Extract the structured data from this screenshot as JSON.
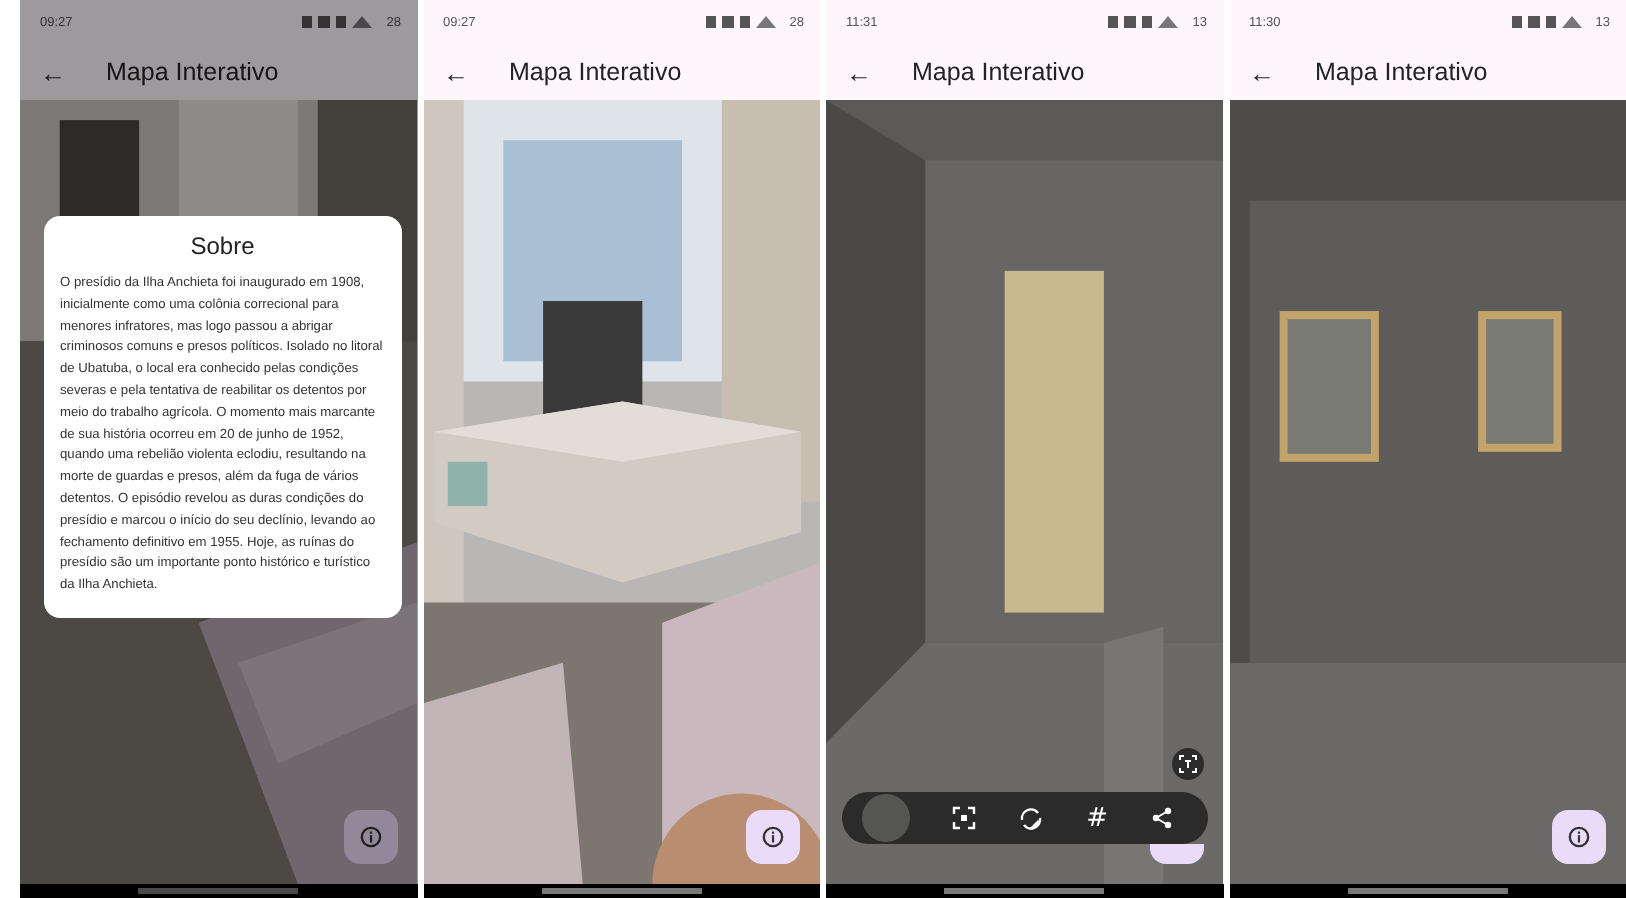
{
  "phones": [
    {
      "status": {
        "time": "09:27",
        "battery": "28"
      },
      "app_bar": {
        "back": "←",
        "title": "Mapa Interativo"
      },
      "dimmed": true,
      "dialog": {
        "title": "Sobre",
        "text": "O presídio da Ilha Anchieta foi inaugurado em 1908, inicialmente como uma colônia correcional para menores infratores, mas logo passou a abrigar criminosos comuns e presos políticos. Isolado no litoral de Ubatuba, o local era conhecido pelas condições severas e pela tentativa de reabilitar os detentos por meio do trabalho agrícola. O momento mais marcante de sua história ocorreu em 20 de junho de 1952, quando uma rebelião violenta eclodiu, resultando na morte de guardas e presos, além da fuga de vários detentos. O episódio revelou as duras condições do presídio e marcou o início do seu declínio, levando ao fechamento definitivo em 1955. Hoje, as ruínas do presídio são um importante ponto histórico e turístico da Ilha Anchieta."
      }
    },
    {
      "status": {
        "time": "09:27",
        "battery": "28"
      },
      "app_bar": {
        "back": "←",
        "title": "Mapa Interativo"
      },
      "view": {
        "kind": "ar"
      },
      "dimmed": false
    },
    {
      "status": {
        "time": "11:31",
        "battery": "13"
      },
      "app_bar": {
        "back": "←",
        "title": "Mapa Interativo"
      },
      "view": {
        "kind": "door"
      },
      "dimmed": false,
      "toolbar": {
        "hash": "#"
      }
    },
    {
      "status": {
        "time": "11:30",
        "battery": "13"
      },
      "app_bar": {
        "back": "←",
        "title": "Mapa Interativo"
      },
      "view": {
        "kind": "windows"
      },
      "dimmed": false
    }
  ]
}
